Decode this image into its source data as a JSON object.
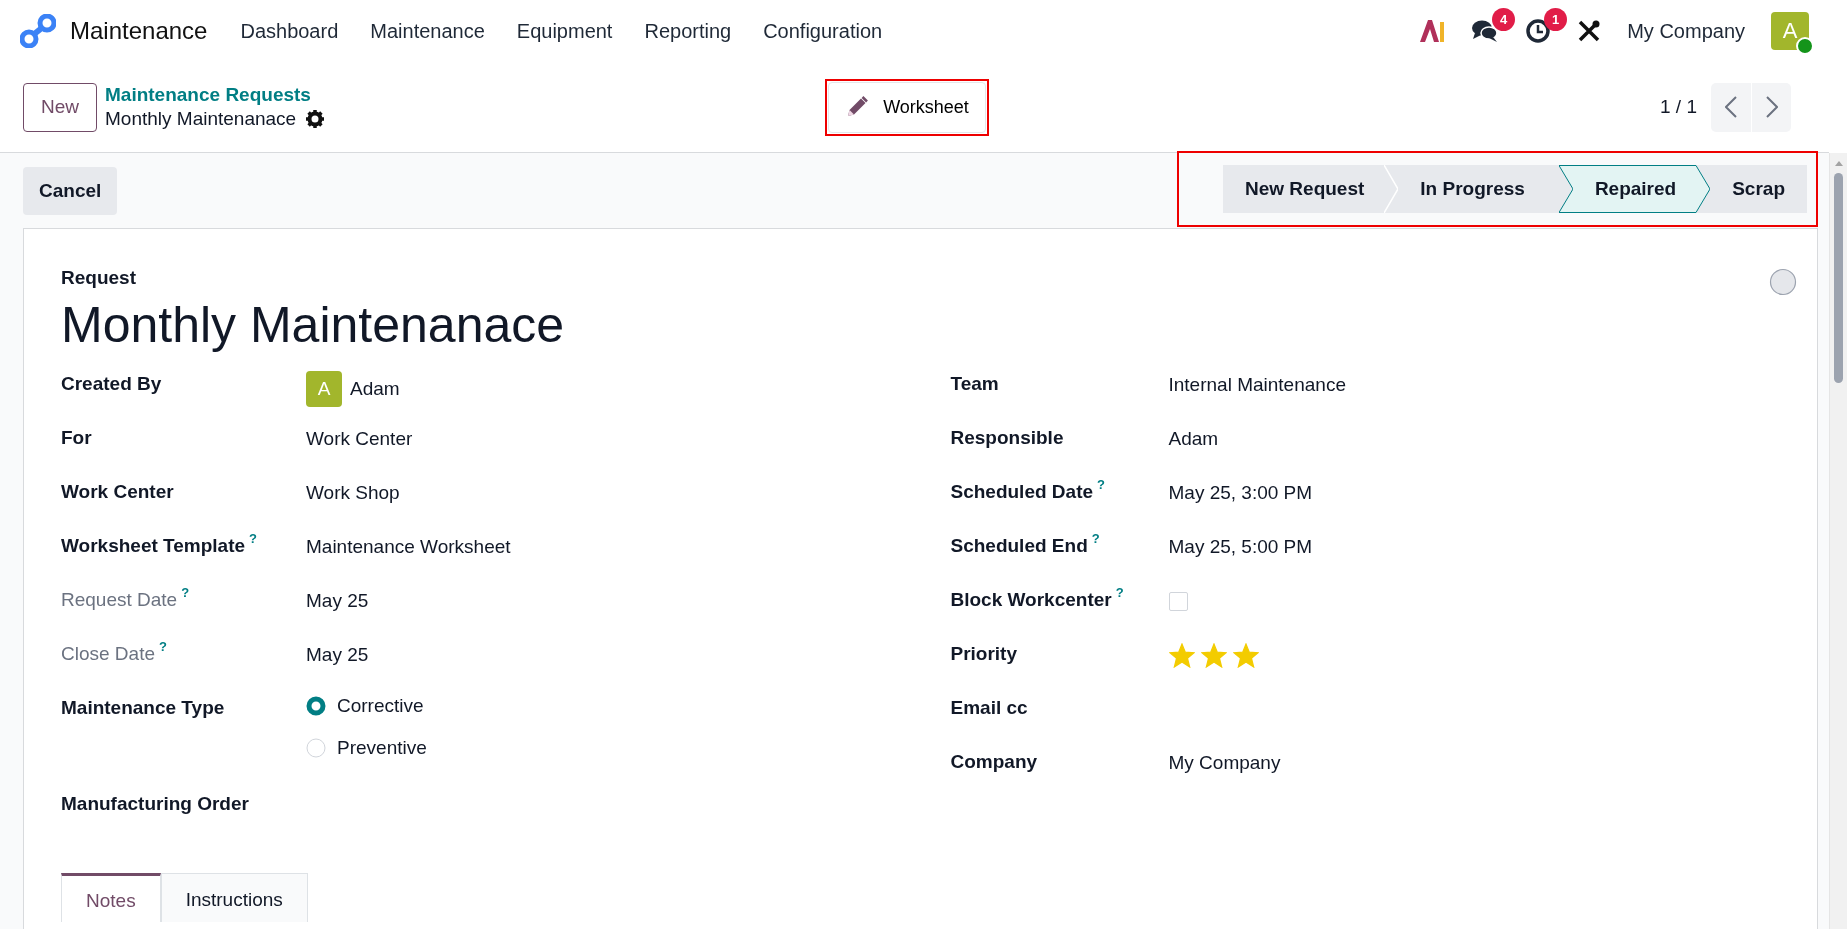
{
  "navbar": {
    "app_name": "Maintenance",
    "menu": [
      "Dashboard",
      "Maintenance",
      "Equipment",
      "Reporting",
      "Configuration"
    ],
    "messages_badge": "4",
    "activities_badge": "1",
    "company": "My Company",
    "user": {
      "initial": "A",
      "online": true
    }
  },
  "control_panel": {
    "new_button": "New",
    "breadcrumb_parent": "Maintenance Requests",
    "breadcrumb_current": "Monthly Maintenanace",
    "action_button": {
      "label": "Worksheet",
      "highlighted": true
    },
    "pager": "1 / 1"
  },
  "status_bar": {
    "cancel_button": "Cancel",
    "highlighted": true,
    "stages": [
      {
        "label": "New Request",
        "selected": false
      },
      {
        "label": "In Progress",
        "selected": false
      },
      {
        "label": "Repaired",
        "selected": true
      },
      {
        "label": "Scrap",
        "selected": false
      }
    ]
  },
  "form": {
    "caption": "Request",
    "title": "Monthly Maintenanace",
    "left_fields": [
      {
        "label": "Created By",
        "kind": "user",
        "initial": "A",
        "value": "Adam",
        "muted": false
      },
      {
        "label": "For",
        "kind": "text",
        "value": "Work Center",
        "muted": false
      },
      {
        "label": "Work Center",
        "kind": "text",
        "value": "Work Shop",
        "muted": false
      },
      {
        "label": "Worksheet Template",
        "kind": "text",
        "value": "Maintenance  Worksheet",
        "help_mark": "?",
        "muted": false
      },
      {
        "label": "Request Date",
        "kind": "text",
        "value": "May 25",
        "help_mark": "?",
        "muted": true
      },
      {
        "label": "Close Date",
        "kind": "text",
        "value": "May 25",
        "help_mark": "?",
        "muted": true
      },
      {
        "label": "Maintenance Type",
        "kind": "radio",
        "muted": false,
        "options": [
          {
            "label": "Corrective",
            "selected": true
          },
          {
            "label": "Preventive",
            "selected": false
          }
        ]
      },
      {
        "label": "Manufacturing Order",
        "kind": "empty",
        "muted": false
      }
    ],
    "right_fields": [
      {
        "label": "Team",
        "kind": "text",
        "value": "Internal Maintenance",
        "muted": false
      },
      {
        "label": "Responsible",
        "kind": "text",
        "value": "Adam",
        "muted": false
      },
      {
        "label": "Scheduled Date",
        "kind": "text",
        "value": "May 25, 3:00 PM",
        "help_mark": "?",
        "muted": false
      },
      {
        "label": "Scheduled End",
        "kind": "text",
        "value": "May 25, 5:00 PM",
        "help_mark": "?",
        "muted": false
      },
      {
        "label": "Block Workcenter",
        "kind": "checkbox",
        "checked": false,
        "help_mark": "?",
        "muted": false
      },
      {
        "label": "Priority",
        "kind": "stars",
        "stars": 3,
        "muted": false
      },
      {
        "label": "Email cc",
        "kind": "empty",
        "muted": false
      },
      {
        "label": "Company",
        "kind": "text",
        "value": "My Company",
        "muted": false
      }
    ],
    "tabs": [
      {
        "label": "Notes",
        "selected": true
      },
      {
        "label": "Instructions",
        "selected": false
      }
    ]
  }
}
